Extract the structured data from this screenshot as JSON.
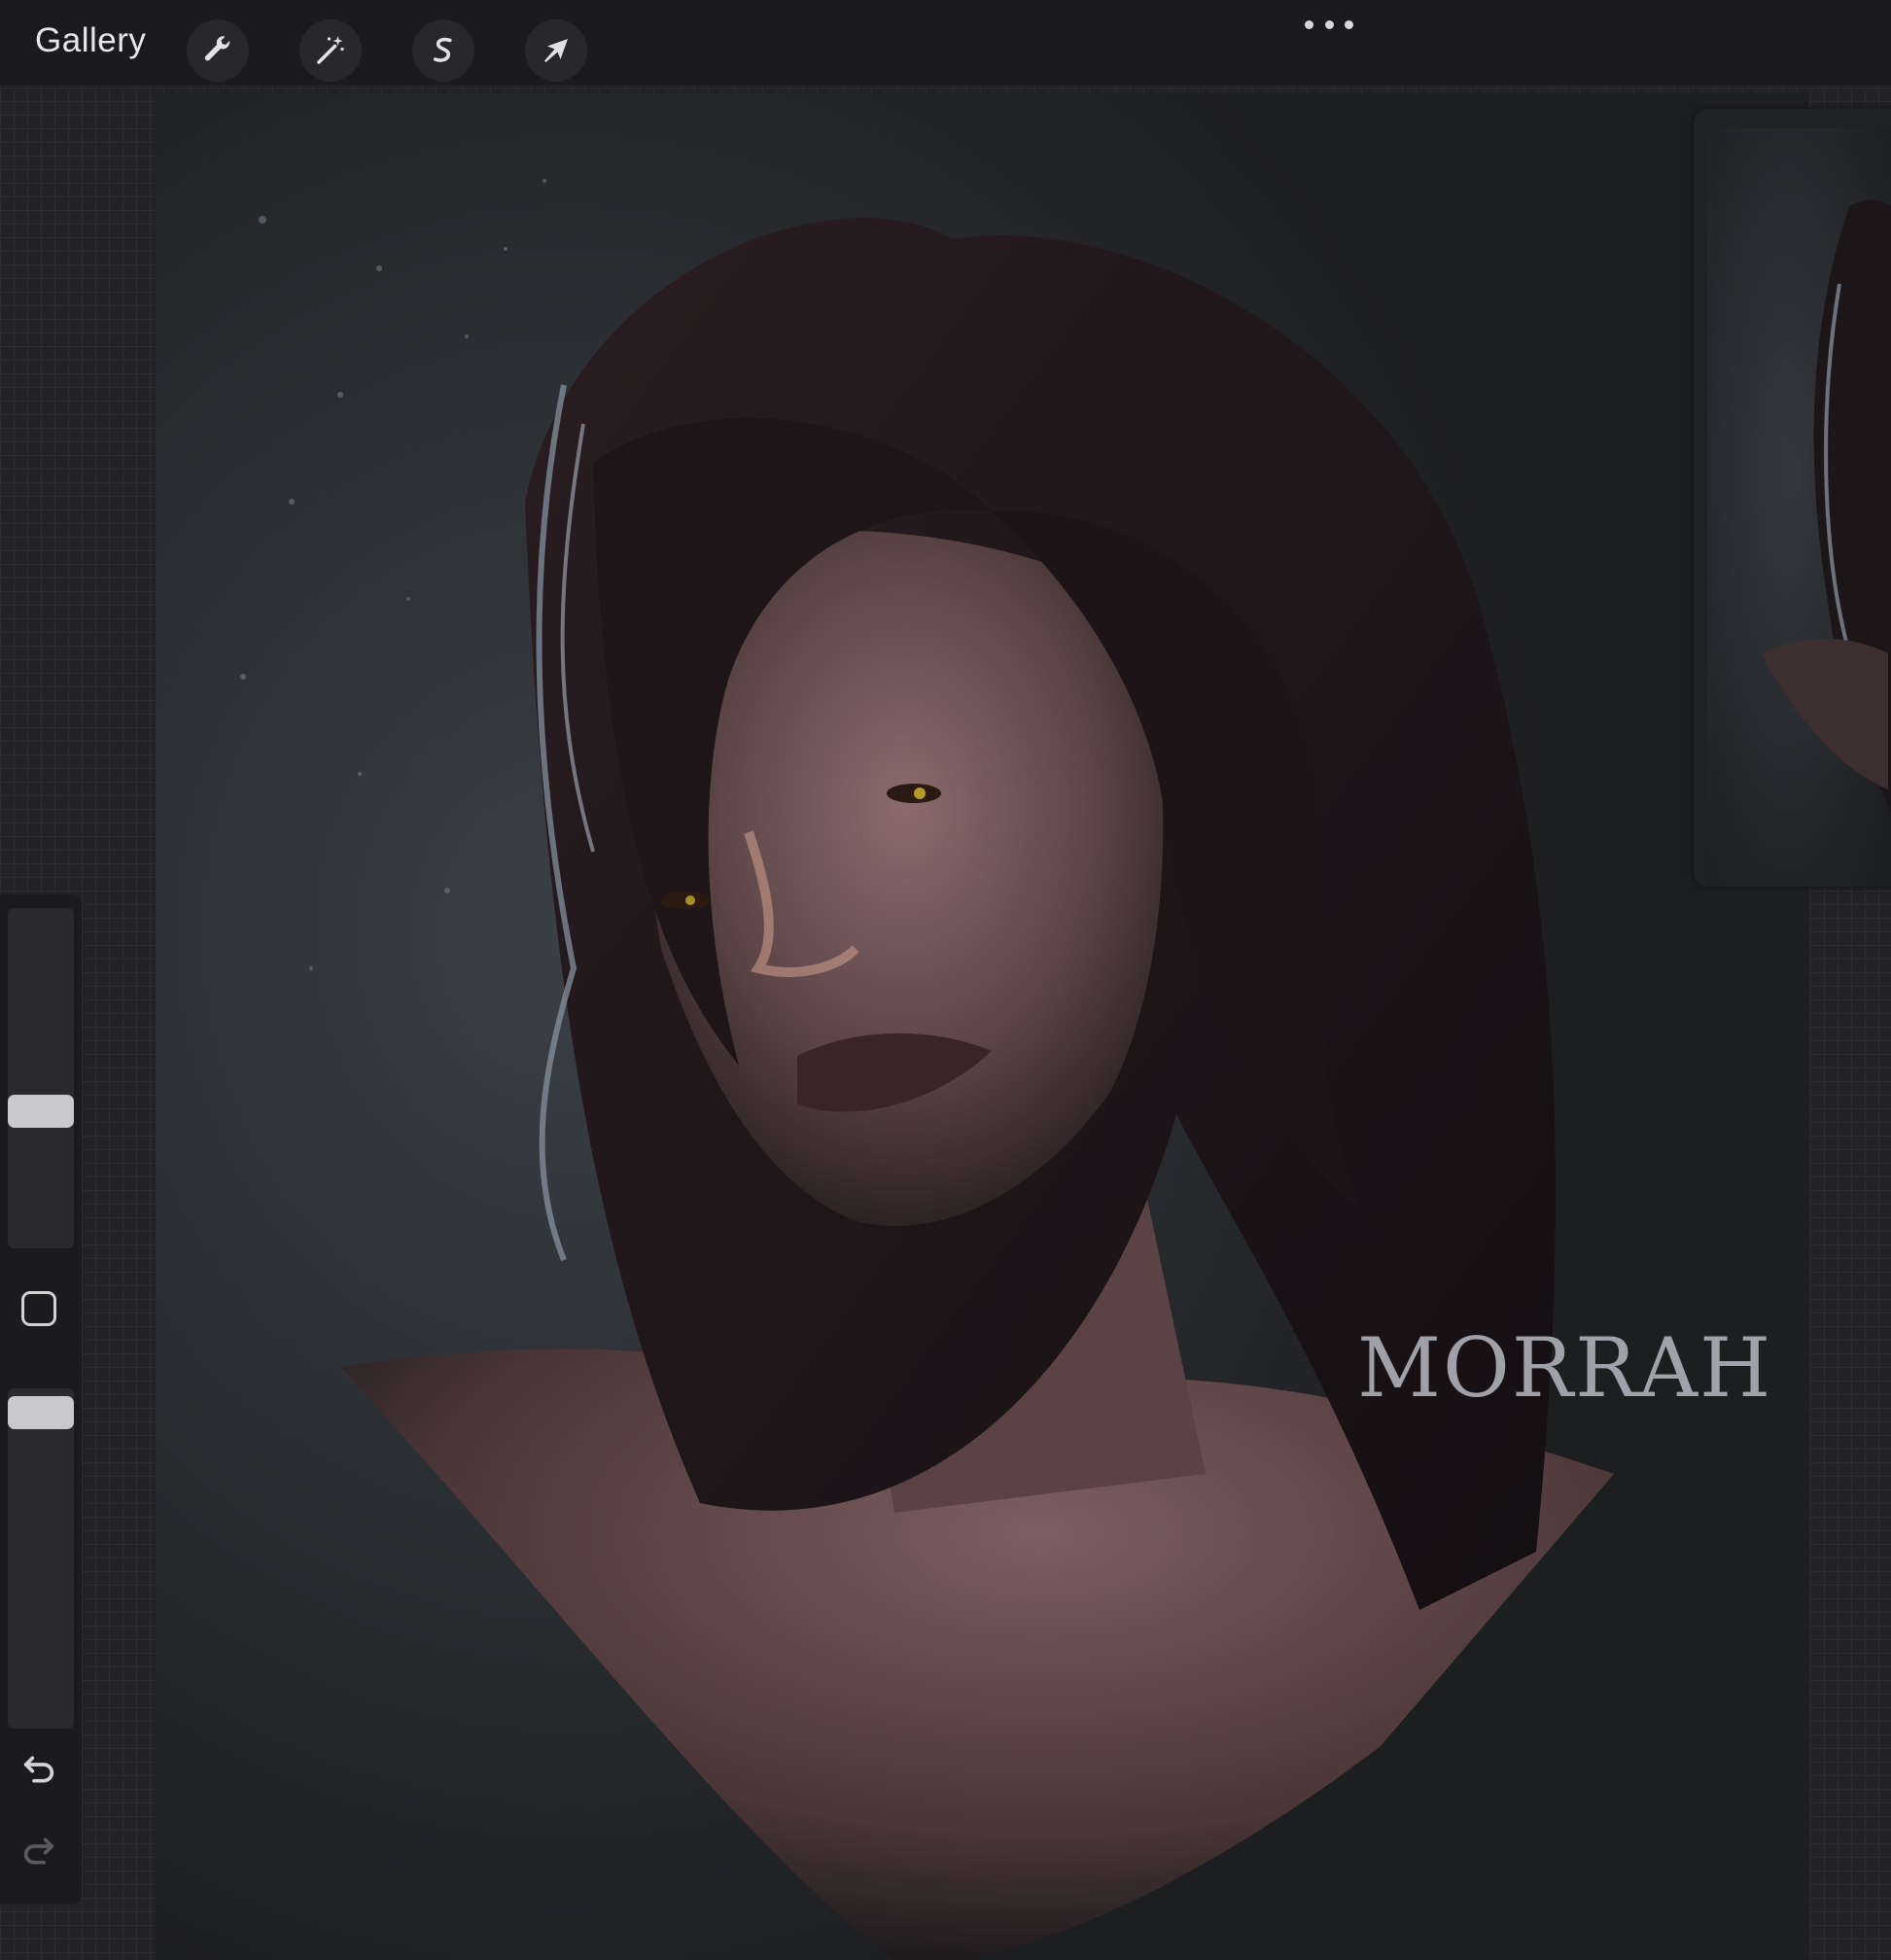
{
  "toolbar": {
    "gallery_label": "Gallery",
    "tools": [
      {
        "name": "actions",
        "icon": "wrench-icon"
      },
      {
        "name": "adjustments",
        "icon": "magic-wand-icon"
      },
      {
        "name": "selection",
        "icon": "selection-s-icon"
      },
      {
        "name": "transform",
        "icon": "arrow-cursor-icon"
      }
    ],
    "more_icon": "ellipsis-icon"
  },
  "canvas": {
    "signature": "MORRAH"
  },
  "sidebar": {
    "brush_size": 0.4,
    "opacity": 0.95,
    "modify_icon": "square-icon",
    "undo_icon": "undo-icon",
    "redo_icon": "redo-icon"
  }
}
